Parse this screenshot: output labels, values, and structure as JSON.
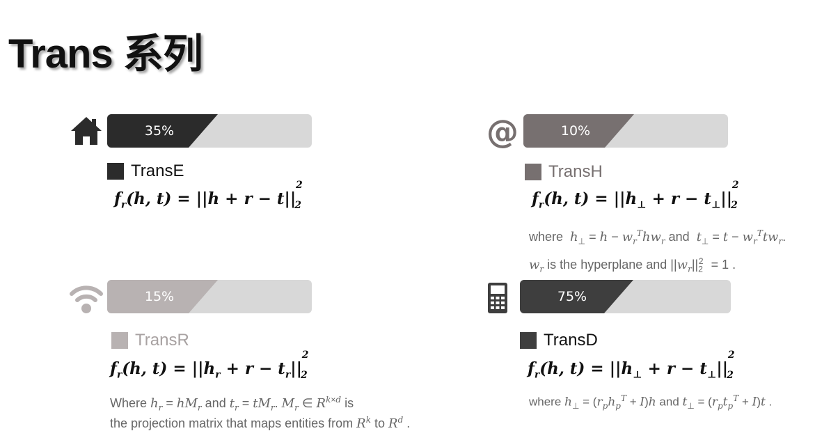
{
  "title": "Trans 系列",
  "colors": {
    "dark": "#2b2b2b",
    "medium": "#777070",
    "light": "#b8b2b2",
    "darkgray": "#3e3e3e",
    "track": "#d8d8d8"
  },
  "cards": [
    {
      "icon": "home-icon",
      "percent": "35%",
      "progress": 0.35,
      "legend": "TransE",
      "formula_text": "f_r(h,t) = ||h + r − t||_2^2",
      "notes": []
    },
    {
      "icon": "at-sign-icon",
      "percent": "10%",
      "progress": 0.1,
      "legend": "TransH",
      "formula_text": "f_r(h,t) = ||h⊥ + r − t⊥||_2^2",
      "notes": [
        "where h⊥ = h − w_r^T h w_r and t⊥ = t − w_r^T t w_r.",
        "w_r is the hyperplane and ||w_r||_2^2 = 1 ."
      ]
    },
    {
      "icon": "wifi-icon",
      "percent": "15%",
      "progress": 0.15,
      "legend": "TransR",
      "formula_text": "f_r(h,t) = ||h_r + r − t_r||_2^2",
      "notes": [
        "Where h_r = hM_r and t_r = tM_r. M_r ∈ R^{k×d} is",
        "the projection matrix that maps entities from R^k to R^d ."
      ]
    },
    {
      "icon": "mobile-phone-icon",
      "percent": "75%",
      "progress": 0.75,
      "legend": "TransD",
      "formula_text": "f_r(h,t) = ||h⊥ + r − t⊥||_2^2",
      "notes": [
        "where h⊥ = (r_p h_p^T + I)h and t⊥ = (r_p t_p^T + I)t ."
      ]
    }
  ]
}
